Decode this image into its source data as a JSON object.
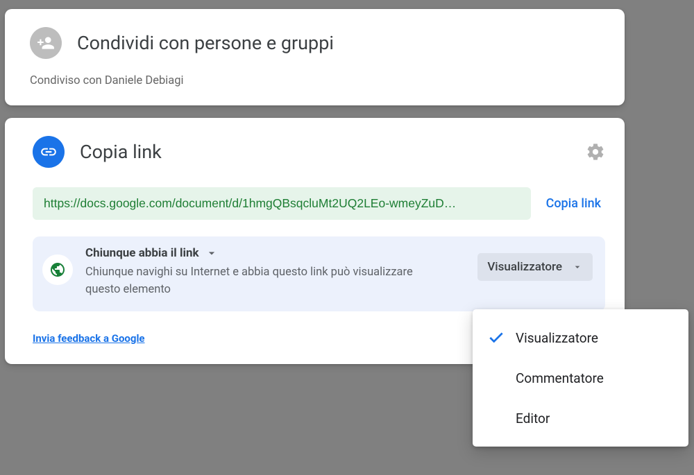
{
  "share_card": {
    "title": "Condividi con persone e gruppi",
    "shared_with": "Condiviso con Daniele Debiagi"
  },
  "link_card": {
    "title": "Copia link",
    "url": "https://docs.google.com/document/d/1hmgQBsqcluMt2UQ2LEo-wmeyZuD…",
    "copy_button": "Copia link",
    "access": {
      "scope_label": "Chiunque abbia il link",
      "description": "Chiunque navighi su Internet e abbia questo link può visualizzare questo elemento",
      "current_role": "Visualizzatore"
    },
    "feedback": "Invia feedback a Google"
  },
  "role_menu": {
    "options": [
      {
        "label": "Visualizzatore",
        "selected": true
      },
      {
        "label": "Commentatore",
        "selected": false
      },
      {
        "label": "Editor",
        "selected": false
      }
    ]
  }
}
